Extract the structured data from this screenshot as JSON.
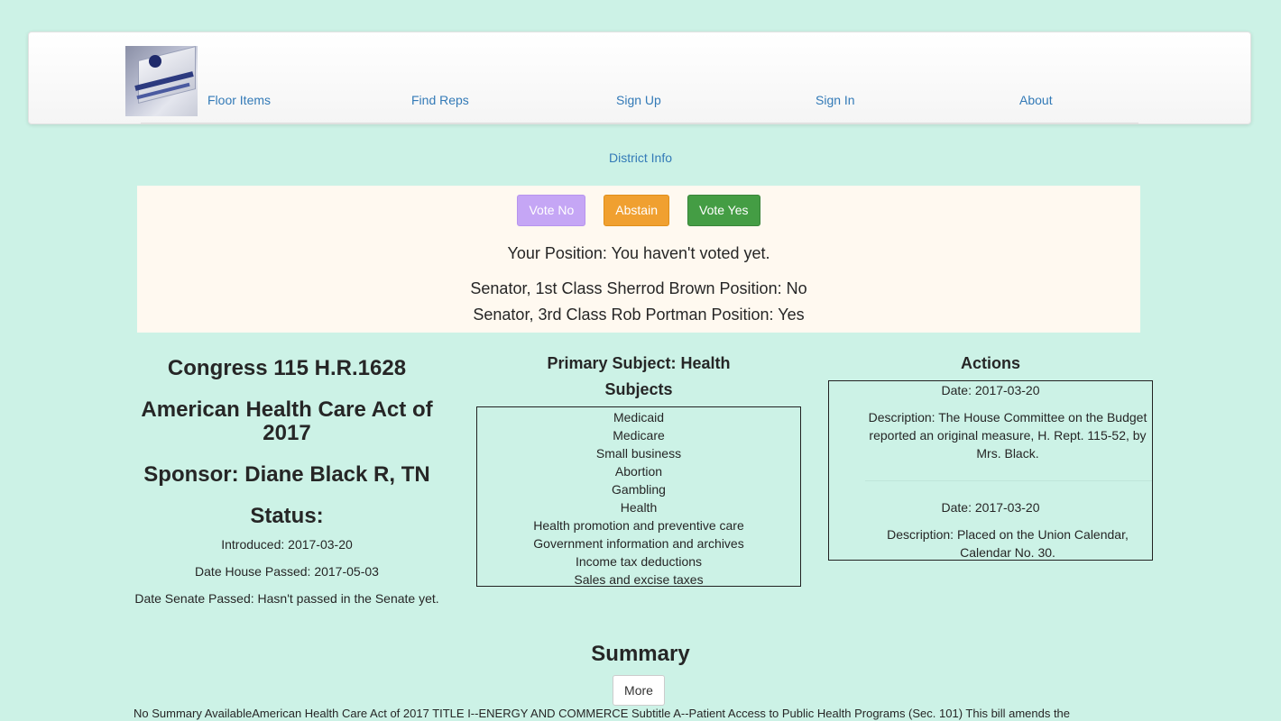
{
  "nav": {
    "logo_alt": "ballot drop box",
    "items": [
      {
        "label": "Floor Items"
      },
      {
        "label": "Find Reps"
      },
      {
        "label": "Sign Up"
      },
      {
        "label": "Sign In"
      },
      {
        "label": "About"
      }
    ],
    "district_info": "District Info"
  },
  "vote": {
    "buttons": {
      "no": "Vote No",
      "abstain": "Abstain",
      "yes": "Vote Yes"
    },
    "your_position": "Your Position: You haven't voted yet.",
    "senators": [
      "Senator, 1st Class Sherrod Brown Position: No",
      "Senator, 3rd Class Rob Portman Position: Yes"
    ]
  },
  "bill": {
    "congress_title": "Congress 115 H.R.1628",
    "name": "American Health Care Act of 2017",
    "sponsor": "Sponsor: Diane Black R, TN",
    "status_heading": "Status:",
    "introduced": "Introduced: 2017-03-20",
    "house_passed": "Date House Passed: 2017-05-03",
    "senate_passed": "Date Senate Passed: Hasn't passed in the Senate yet."
  },
  "subjects": {
    "primary": "Primary Subject: Health",
    "heading": "Subjects",
    "items": [
      "Medicaid",
      "Medicare",
      "Small business",
      "Abortion",
      "Gambling",
      "Health",
      "Health promotion and preventive care",
      "Government information and archives",
      "Income tax deductions",
      "Sales and excise taxes"
    ]
  },
  "actions": {
    "heading": "Actions",
    "items": [
      {
        "date": "Date: 2017-03-20",
        "description": "Description: The House Committee on the Budget reported an original measure, H. Rept. 115-52, by Mrs. Black."
      },
      {
        "date": "Date: 2017-03-20",
        "description": "Description: Placed on the Union Calendar, Calendar No. 30."
      }
    ]
  },
  "summary": {
    "heading": "Summary",
    "more_label": "More",
    "text": "No Summary AvailableAmerican Health Care Act of 2017 TITLE I--ENERGY AND COMMERCE Subtitle A--Patient Access to Public Health Programs (Sec. 101) This bill amends the"
  },
  "colors": {
    "page_bg": "#ccf2e6",
    "link": "#337ab7",
    "vote_no": "#c5a6f5",
    "abstain": "#f0a030",
    "vote_yes": "#449d44",
    "panel_bg": "#fff9f0"
  }
}
